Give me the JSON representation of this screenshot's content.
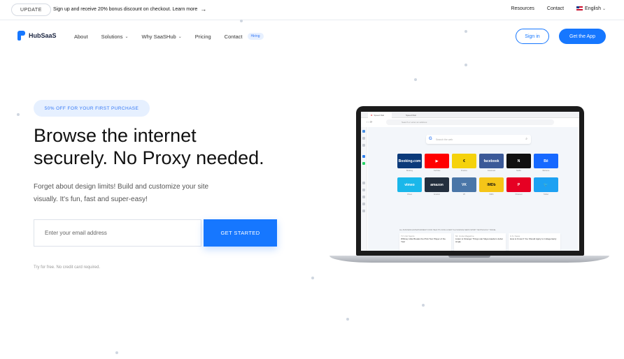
{
  "topbar": {
    "badge": "UPDATE",
    "promo_text": "Sign up and receive 20% bonus discount on checkout. Learn more",
    "promo_arrow": "→",
    "links": [
      "Resources",
      "Contact"
    ],
    "language": "English"
  },
  "nav": {
    "brand": "HubSaaS",
    "items": [
      {
        "label": "About"
      },
      {
        "label": "Solutions"
      },
      {
        "label": "Why SaaSHub"
      },
      {
        "label": "Pricing"
      },
      {
        "label": "Contact"
      }
    ],
    "hiring_badge": "Hiring",
    "signin_label": "Sign in",
    "cta_label": "Get the App"
  },
  "hero": {
    "offer_badge": "50% OFF FOR YOUR FIRST PURCHASE",
    "title_line1": "Browse the internet",
    "title_line2": "securely. No Proxy needed.",
    "subtitle_line1": "Forget about design limits! Build and customize your site",
    "subtitle_line2": "visually. It's fun, fast and super-easy!",
    "email_placeholder": "Enter your email address",
    "cta_label": "GET STARTED",
    "note": "Try for free. No credit card required."
  },
  "browser": {
    "tab1": "Speed Dial",
    "tab2": "Speed Dial",
    "address_placeholder": "Search or enter an address",
    "search_placeholder": "Search the web",
    "dials": [
      {
        "label": "Booking.com",
        "caption": "Booking",
        "color": "#0b3a7a"
      },
      {
        "label": "▶",
        "caption": "YouTube",
        "color": "#ff0000"
      },
      {
        "label": "€",
        "caption": "Finance",
        "color": "#f5d20c"
      },
      {
        "label": "facebook",
        "caption": "Facebook",
        "color": "#3b5998"
      },
      {
        "label": "N",
        "caption": "Netflix",
        "color": "#111111"
      },
      {
        "label": "Bē",
        "caption": "Behance",
        "color": "#1769ff"
      },
      {
        "label": "vimeo",
        "caption": "Vimeo",
        "color": "#1ab7ea"
      },
      {
        "label": "amazon",
        "caption": "Amazon",
        "color": "#232f3e"
      },
      {
        "label": "VK",
        "caption": "VK",
        "color": "#4a76a8"
      },
      {
        "label": "IMDb",
        "caption": "IMDb",
        "color": "#f5c518"
      },
      {
        "label": "P",
        "caption": "Pinterest",
        "color": "#e60023"
      },
      {
        "label": "🐦",
        "caption": "Twitter",
        "color": "#1da1f2"
      }
    ],
    "news_categories": "ALL   BUSINESS   ENTERTAINMENT   FOOD   HEALTH   LIVING   LIFESTYLE   SCIENCE   NEWS   SPORT   TECHNOLOGY   TRAVEL",
    "news": [
      {
        "source": "TV Unit Sports",
        "headline": "Whitney Vale Breaks the PGA Tour Player of the Year"
      },
      {
        "source": "Mr. Uncle Magazine",
        "headline": "Listen to Stranger Things star Maya Hawke's debut single"
      },
      {
        "source": "U.S. News",
        "headline": "How to Know If You Should Apply to College Early"
      }
    ]
  },
  "colors": {
    "accent": "#1677ff",
    "offer_bg": "#e6f0ff",
    "offer_text": "#3478f6"
  }
}
